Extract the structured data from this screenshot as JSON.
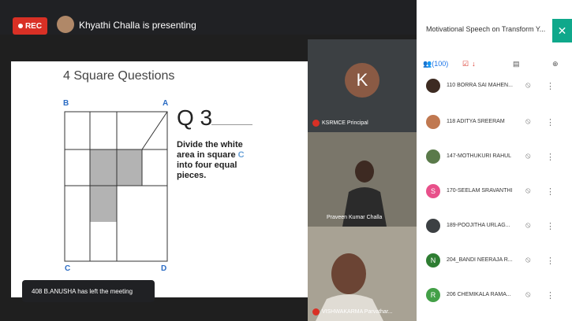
{
  "meeting": {
    "rec_label": "REC",
    "presenting_text": "Khyathi Challa is presenting",
    "toast": "408 B.ANUSHA has left the meeting"
  },
  "slide": {
    "title": "4 Square Questions",
    "grid_labels": {
      "b": "B",
      "a": "A",
      "c": "C",
      "d": "D"
    },
    "question_number": "Q 3",
    "question_parts": [
      "Divide the white area in square ",
      "C",
      " into four equal pieces."
    ]
  },
  "tiles": [
    {
      "name": "KSRMCE Principal",
      "avatar_letter": "K",
      "avatar_color": "#8a5a44"
    },
    {
      "name": "Praveen Kumar Challa"
    },
    {
      "name": "VISHWAKARMA Parvathar..."
    }
  ],
  "panel": {
    "title": "Motivational Speech on Transform Y...",
    "close_icon": "close-icon",
    "tabs": {
      "people_count": "(100)"
    },
    "participants": [
      {
        "name": "110 BORRA SAI MAHEN...",
        "avatar_color": "#3d2b22"
      },
      {
        "name": "118 ADITYA SREERAM",
        "avatar_color": "#c07850"
      },
      {
        "name": "147-MOTHUKURI RAHUL",
        "avatar_color": "#5a7a4a"
      },
      {
        "name": "170-SEELAM SRAVANTHI",
        "avatar_color": "#e8508a",
        "letter": "S"
      },
      {
        "name": "189-POOJITHA URLAG...",
        "avatar_color": "#3c4043"
      },
      {
        "name": "204_BANDI NEERAJA R...",
        "avatar_color": "#2e7d32",
        "letter": "N"
      },
      {
        "name": "206 CHEMIKALA RAMA...",
        "avatar_color": "#43a047",
        "letter": "R"
      }
    ]
  },
  "colors": {
    "rec": "#d93025",
    "accent": "#0fa88b",
    "grid_shade": "#b3b3b3"
  }
}
